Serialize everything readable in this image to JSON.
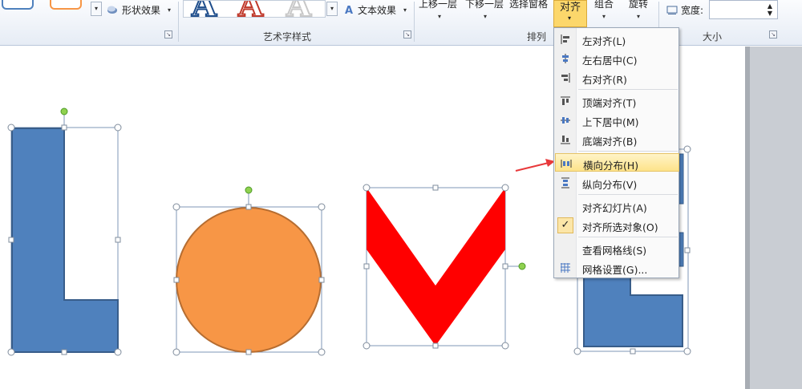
{
  "ribbon": {
    "shape_effects": "形状效果",
    "text_effects": "文本效果",
    "wordart_group": "艺术字样式",
    "arrange_group": "排列",
    "size_group": "大小",
    "bring_forward": "上移一层",
    "send_backward": "下移一层",
    "selection_pane": "选择窗格",
    "align": "对齐",
    "group": "组合",
    "rotate": "旋转",
    "width_label": "宽度:",
    "width_value": ""
  },
  "align_menu": {
    "items": [
      {
        "label": "左对齐(L)",
        "icon": "align-left-icon"
      },
      {
        "label": "左右居中(C)",
        "icon": "align-center-icon"
      },
      {
        "label": "右对齐(R)",
        "icon": "align-right-icon"
      },
      {
        "label": "顶端对齐(T)",
        "icon": "align-top-icon"
      },
      {
        "label": "上下居中(M)",
        "icon": "align-middle-icon"
      },
      {
        "label": "底端对齐(B)",
        "icon": "align-bottom-icon"
      },
      {
        "label": "横向分布(H)",
        "icon": "distribute-horizontal-icon",
        "highlighted": true
      },
      {
        "label": "纵向分布(V)",
        "icon": "distribute-vertical-icon"
      },
      {
        "label": "对齐幻灯片(A)",
        "icon": ""
      },
      {
        "label": "对齐所选对象(O)",
        "icon": "check-icon",
        "checked": true
      },
      {
        "label": "查看网格线(S)",
        "icon": ""
      },
      {
        "label": "网格设置(G)...",
        "icon": "grid-icon"
      }
    ]
  },
  "colors": {
    "shape_blue": "#4f81bd",
    "shape_orange": "#f79646",
    "shape_red": "#ff0000",
    "highlight": "#fde38a",
    "arrow_red": "#e8393b"
  }
}
